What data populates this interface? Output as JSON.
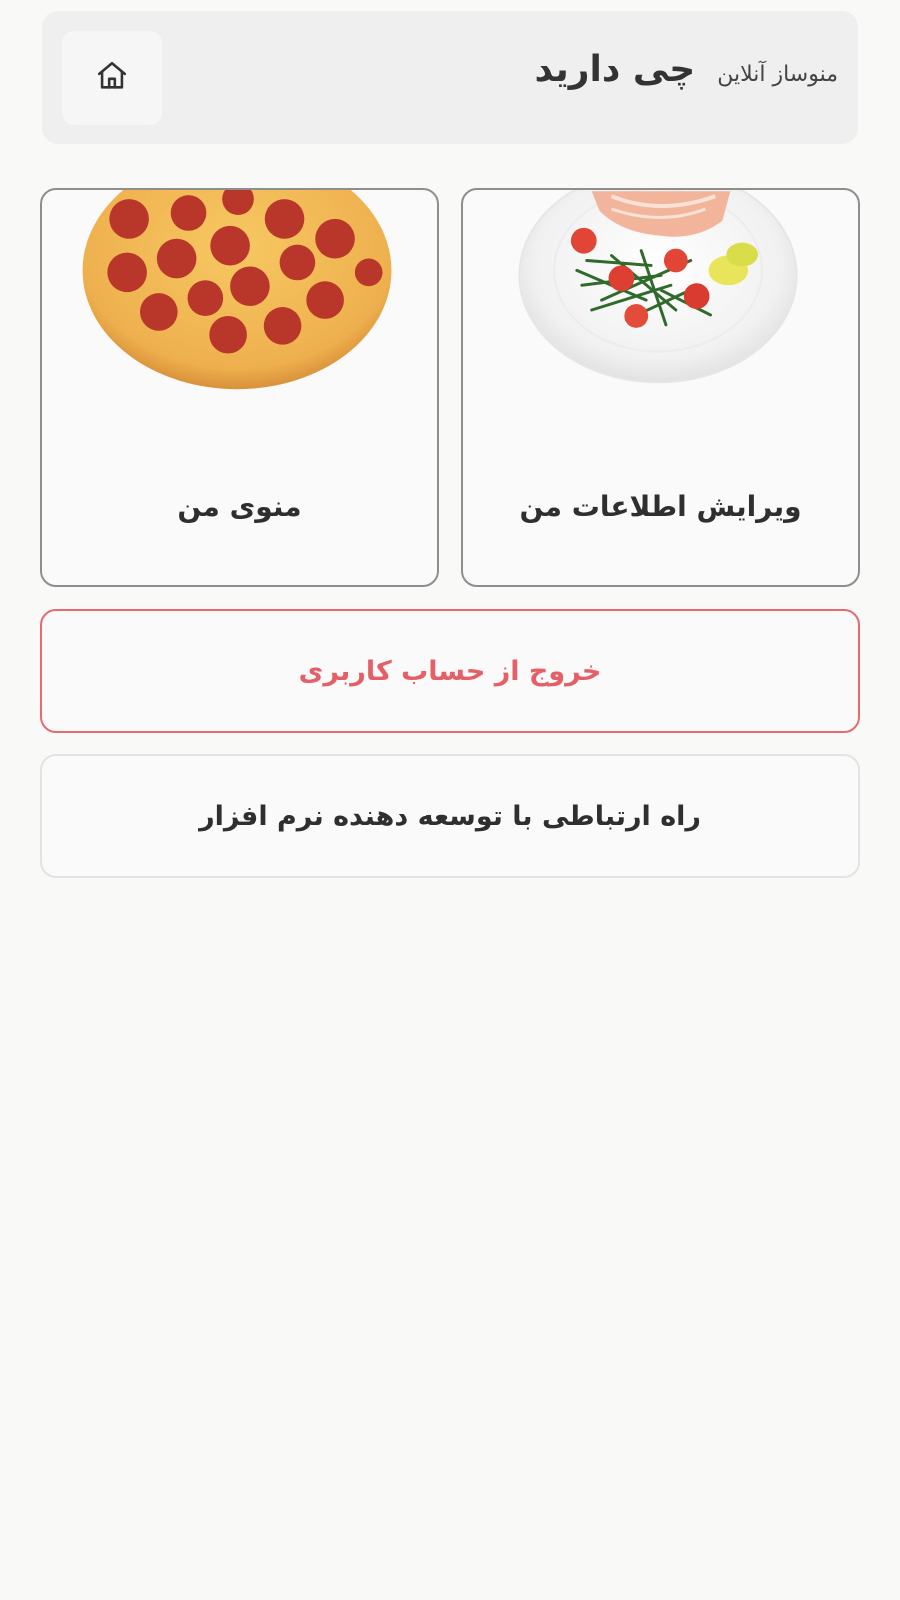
{
  "header": {
    "title": "چی دارید",
    "subtitle": "منوساز آنلاین",
    "home_icon": "home-icon"
  },
  "cards": [
    {
      "label": "ویرایش اطلاعات من",
      "image": "salmon-salad-plate"
    },
    {
      "label": "منوی من",
      "image": "pepperoni-pizza"
    }
  ],
  "buttons": {
    "logout": "خروج از حساب کاربری",
    "contact_developer": "راه ارتباطی با توسعه دهنده نرم افزار"
  },
  "colors": {
    "danger": "#e45f66",
    "header_bg": "#efefef",
    "page_bg": "#f9f9f8"
  }
}
